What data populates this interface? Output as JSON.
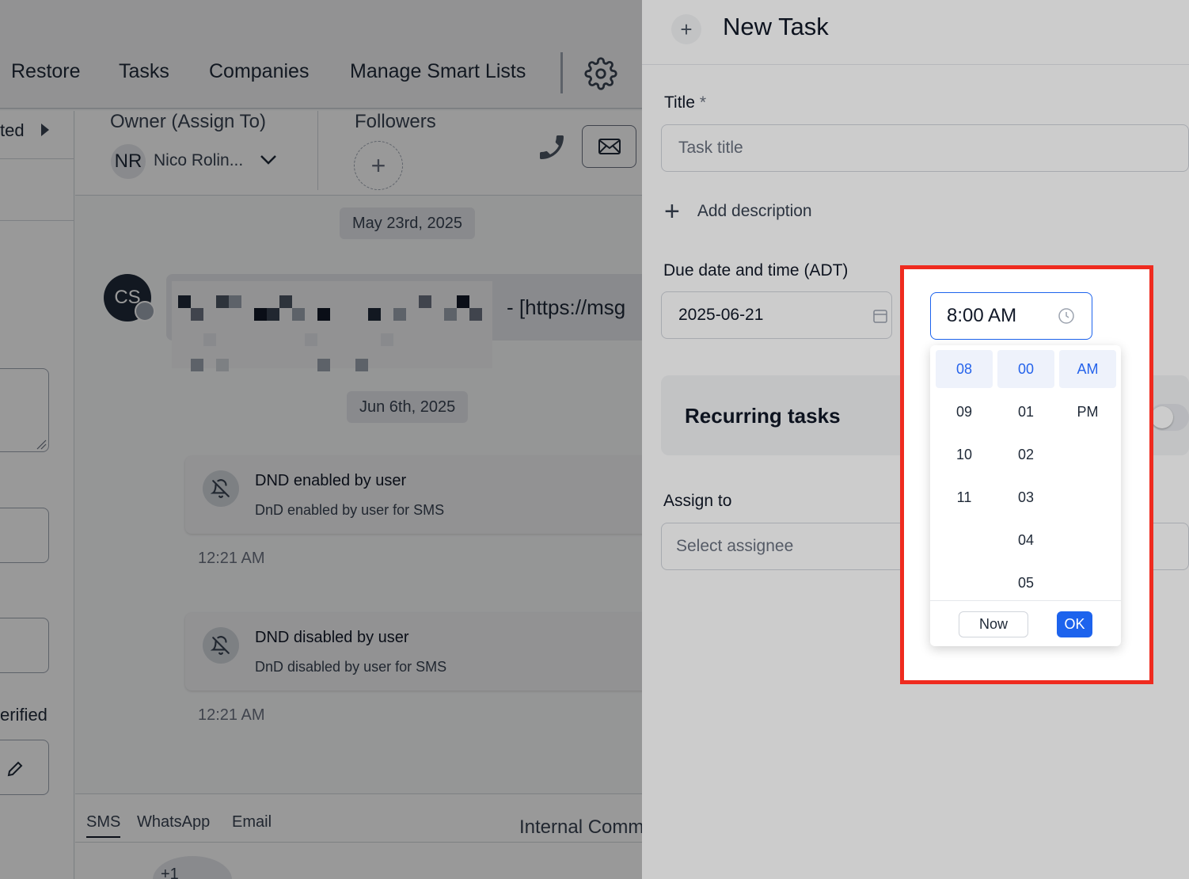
{
  "nav": {
    "items": [
      "Restore",
      "Tasks",
      "Companies",
      "Manage Smart Lists"
    ],
    "settings_icon": "gear-icon"
  },
  "left_column": {
    "partial_label_top": "ted",
    "partial_label_verified": "erified"
  },
  "owner_bar": {
    "owner_label": "Owner (Assign To)",
    "owner_initials": "NR",
    "owner_name": "Nico Rolin...",
    "followers_label": "Followers"
  },
  "conversation": {
    "date_1": "May 23rd, 2025",
    "avatar_initials": "CS",
    "message_visible_text": "-  [https://msg",
    "date_2": "Jun 6th, 2025",
    "events": [
      {
        "title": "DND enabled by user",
        "subtitle": "DnD enabled by user for SMS",
        "time": "12:21 AM"
      },
      {
        "title": "DND disabled by user",
        "subtitle": "DnD disabled by user for SMS",
        "time": "12:21 AM"
      }
    ]
  },
  "composer": {
    "tabs": [
      "SMS",
      "WhatsApp",
      "Email"
    ],
    "active_tab": "SMS",
    "internal_label": "Internal Comm",
    "count_badge": "+1"
  },
  "panel": {
    "title": "New Task",
    "title_label": "Title",
    "required_mark": "*",
    "title_placeholder": "Task title",
    "add_description": "Add description",
    "due_label": "Due date and time (ADT)",
    "due_date": "2025-06-21",
    "due_time": "8:00 AM",
    "recurring_label": "Recurring tasks",
    "recurring_enabled": false,
    "assign_label": "Assign to",
    "assign_placeholder": "Select assignee"
  },
  "time_picker": {
    "hours": [
      "08",
      "09",
      "10",
      "11"
    ],
    "minutes": [
      "00",
      "01",
      "02",
      "03",
      "04",
      "05"
    ],
    "meridiem": [
      "AM",
      "PM"
    ],
    "selected_hour": "08",
    "selected_minute": "00",
    "selected_meridiem": "AM",
    "now_label": "Now",
    "ok_label": "OK"
  },
  "colors": {
    "accent": "#1d63ed",
    "highlight_border": "#ef2b1f",
    "selected_cell_bg": "#eef2fb"
  }
}
